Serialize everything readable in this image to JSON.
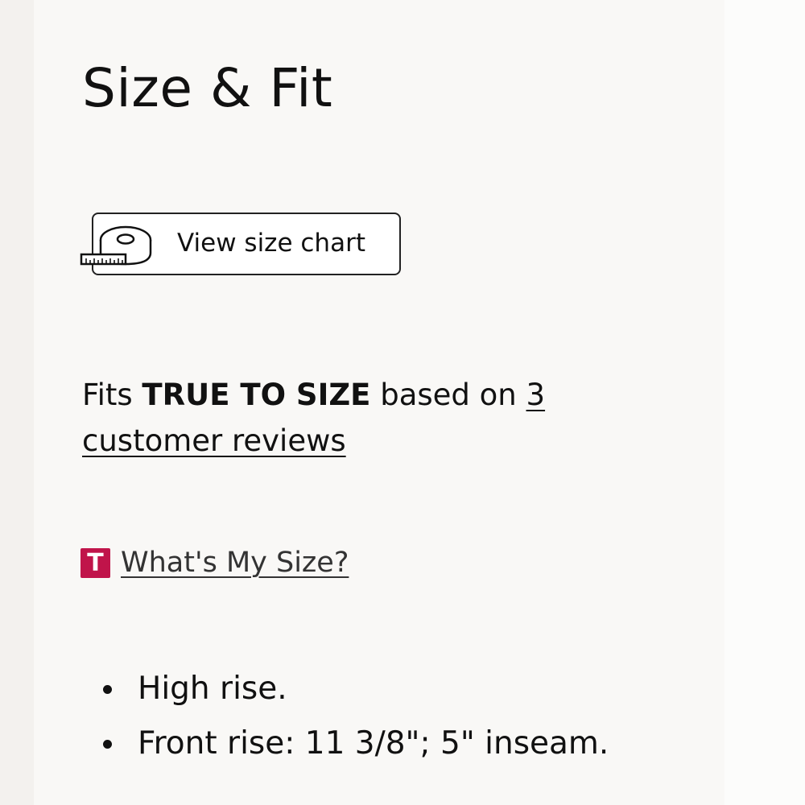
{
  "section": {
    "title": "Size & Fit"
  },
  "size_chart_button": {
    "label": "View size chart",
    "icon": "measuring-tape-icon"
  },
  "fit_summary": {
    "prefix": "Fits ",
    "fit_value": "TRUE TO SIZE",
    "middle": " based on ",
    "reviews_link": "3 customer reviews"
  },
  "whats_my_size": {
    "logo_letter": "T",
    "logo_color": "#c0144a",
    "label": "What's My Size?"
  },
  "details": [
    "High rise.",
    "Front rise: 11 3/8\"; 5\" inseam."
  ]
}
